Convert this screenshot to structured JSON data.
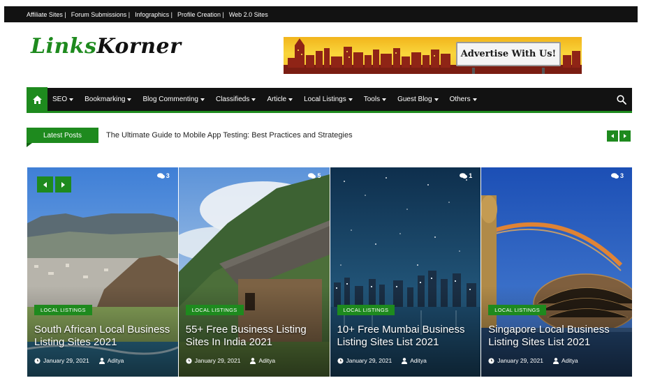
{
  "topbar": {
    "links": [
      "Affiliate Sites |",
      "Forum Submissions |",
      "Infographics |",
      "Profile Creation |",
      "Web 2.0 Sites"
    ]
  },
  "logo": {
    "part1": "Links",
    "part2": "Korner"
  },
  "ad": {
    "text": "Advertise With Us!"
  },
  "nav": {
    "home_icon": "home-icon",
    "items": [
      "SEO",
      "Bookmarking",
      "Blog Commenting",
      "Classifieds",
      "Article",
      "Local Listings",
      "Tools",
      "Guest Blog",
      "Others"
    ],
    "search_icon": "search-icon"
  },
  "ticker": {
    "label": "Latest Posts",
    "text": "The Ultimate Guide to Mobile App Testing: Best Practices and Strategies"
  },
  "cards": [
    {
      "comments": "3",
      "tag": "LOCAL LISTINGS",
      "title": "South African Local Business Listing Sites 2021",
      "date": "January 29, 2021",
      "author": "Aditya"
    },
    {
      "comments": "5",
      "tag": "LOCAL LISTINGS",
      "title": "55+ Free Business Listing Sites In India 2021",
      "date": "January 29, 2021",
      "author": "Aditya"
    },
    {
      "comments": "1",
      "tag": "LOCAL LISTINGS",
      "title": "10+ Free Mumbai Business Listing Sites List 2021",
      "date": "January 29, 2021",
      "author": "Aditya"
    },
    {
      "comments": "3",
      "tag": "LOCAL LISTINGS",
      "title": "Singapore Local Business Listing Sites List 2021",
      "date": "January 29, 2021",
      "author": "Aditya"
    }
  ],
  "colors": {
    "brand_green": "#1e8a1e",
    "dark_bar": "#121212"
  }
}
